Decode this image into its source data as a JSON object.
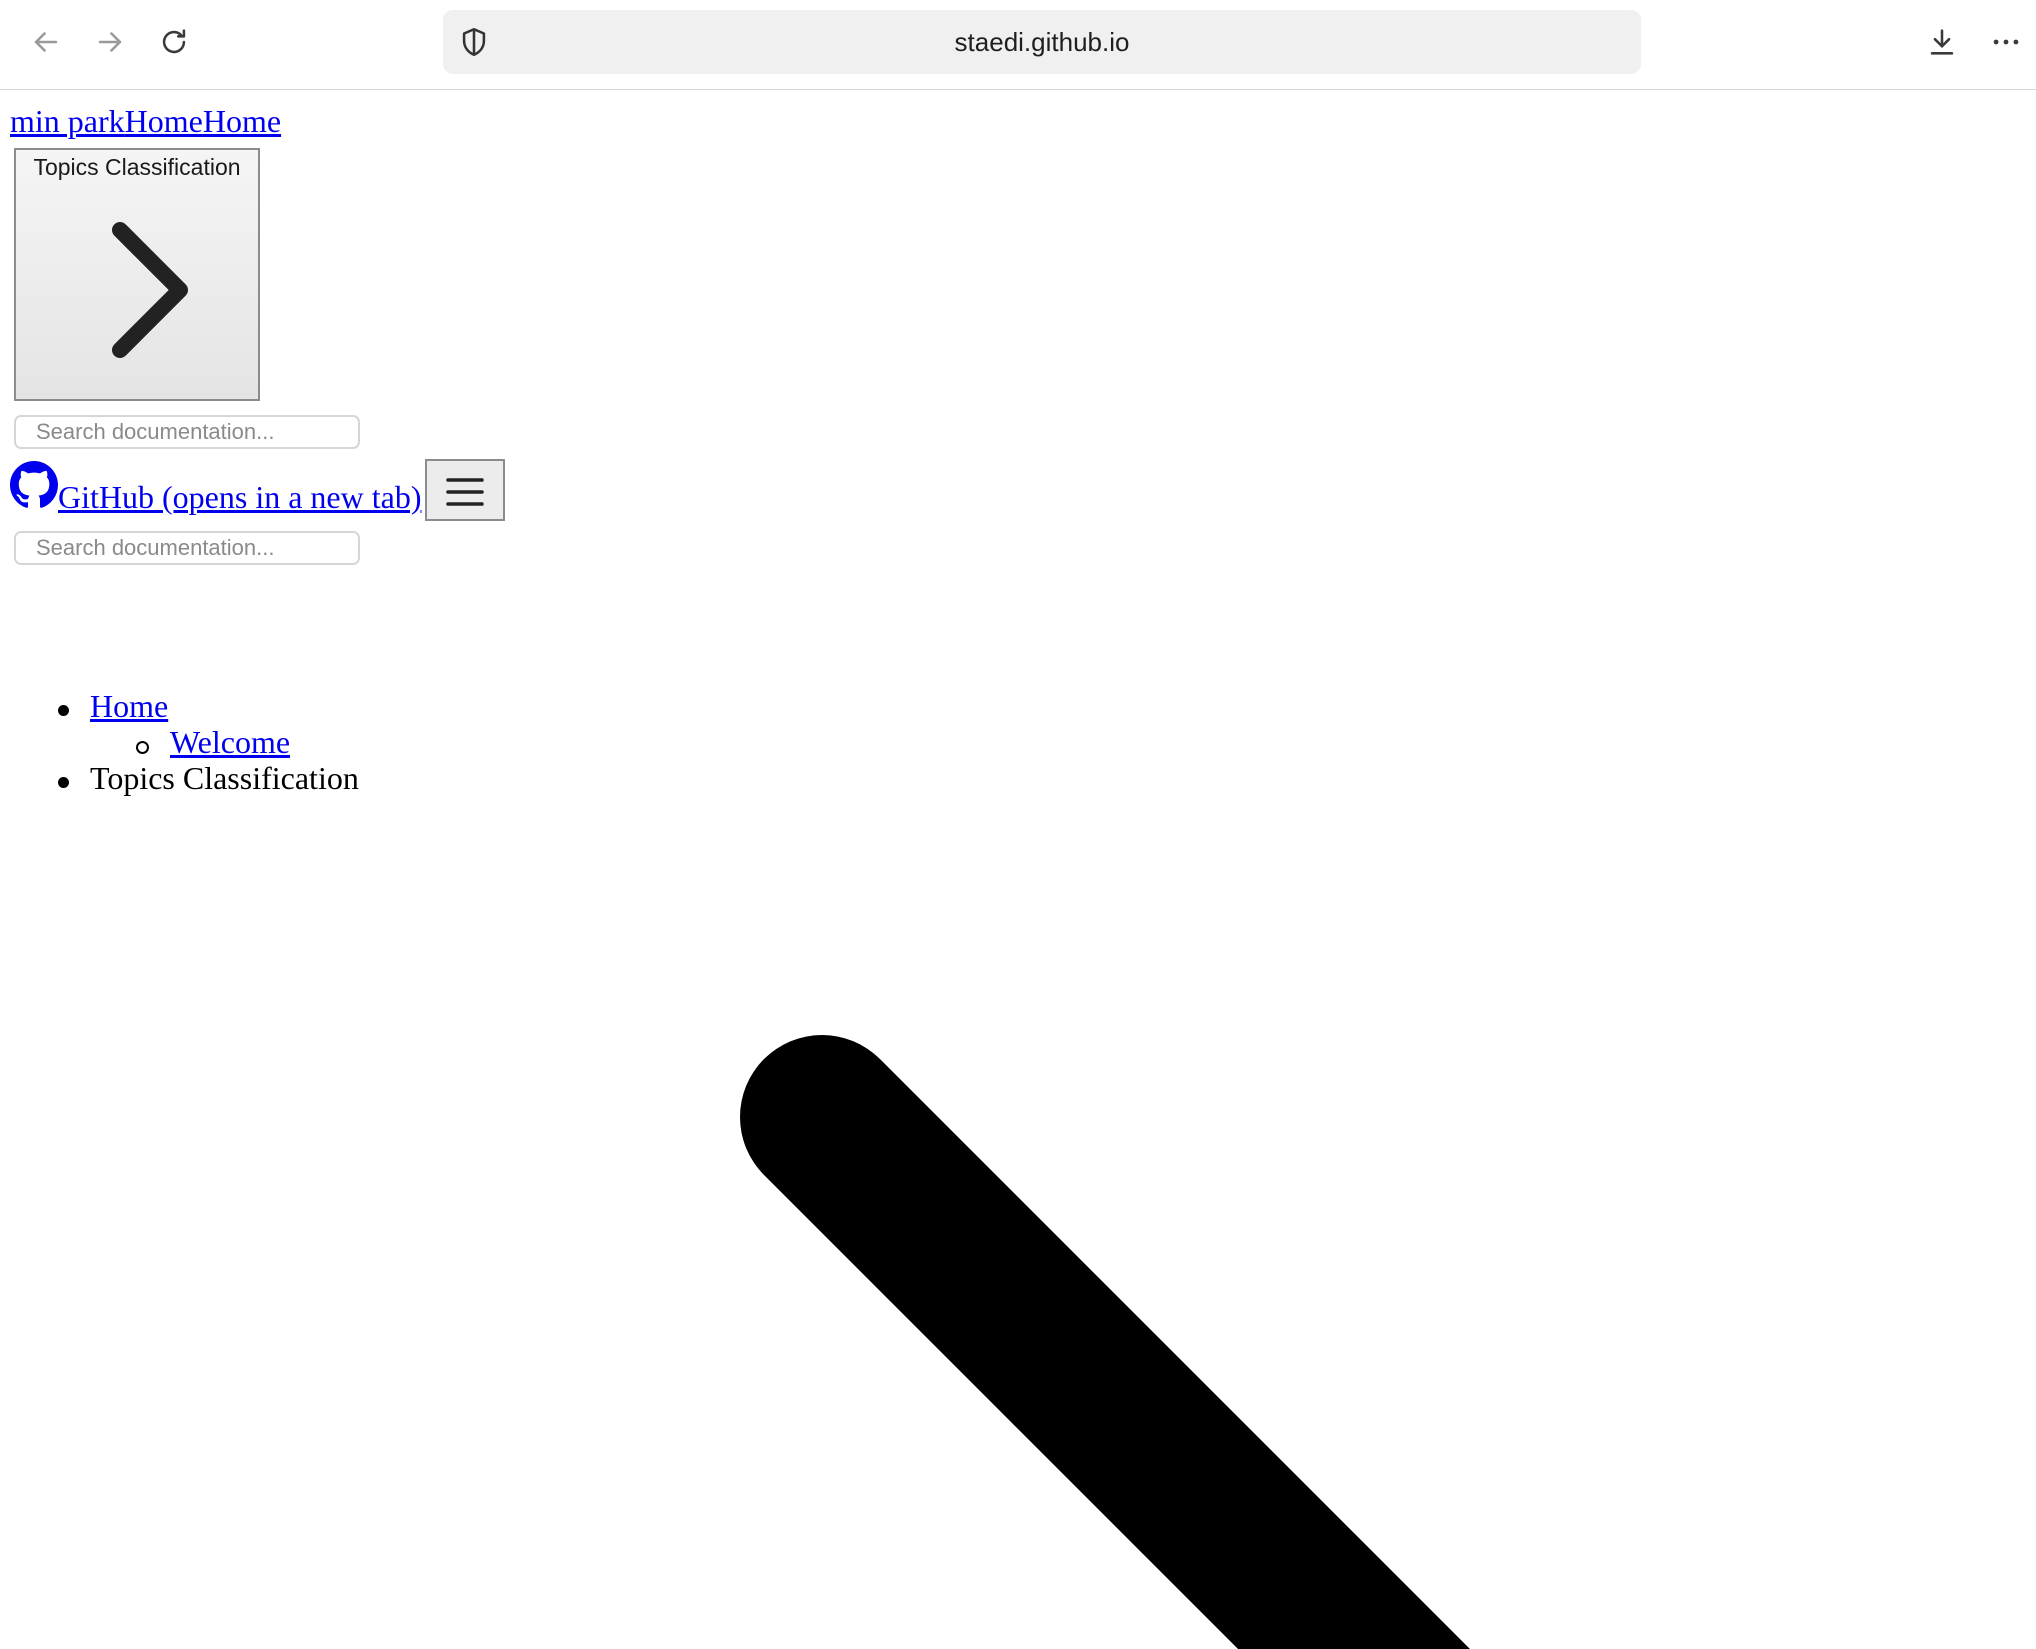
{
  "browser": {
    "url": "staedi.github.io",
    "icons": [
      "back-arrow-icon",
      "forward-arrow-icon",
      "reload-icon",
      "shield-icon",
      "download-icon",
      "more-icon"
    ]
  },
  "site": {
    "brand_parts": [
      "min park",
      "Home",
      "Home"
    ],
    "topics_button_label": "Topics Classification",
    "search_placeholder": "Search documentation...",
    "github_link": "GitHub (opens in a new tab)"
  },
  "nav": {
    "items": [
      {
        "label": "Home",
        "children": [
          {
            "label": "Welcome"
          }
        ]
      },
      {
        "label": "Topics Classification"
      }
    ]
  }
}
